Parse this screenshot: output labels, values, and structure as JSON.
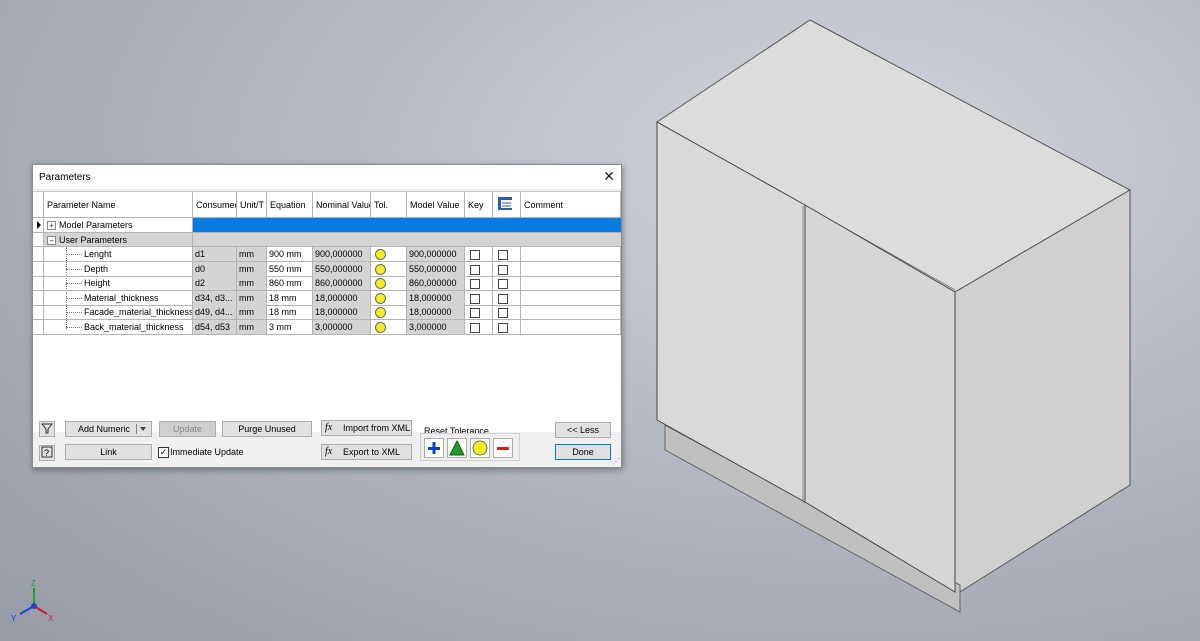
{
  "dialog": {
    "title": "Parameters",
    "close_glyph": "✕"
  },
  "columns": [
    "Parameter Name",
    "Consumed",
    "Unit/T",
    "Equation",
    "Nominal Value",
    "Tol.",
    "Key",
    "Comment",
    "Model Value"
  ],
  "groups": {
    "model": "Model Parameters",
    "user": "User Parameters"
  },
  "params": [
    {
      "name": "Lenght",
      "consumed": "d1",
      "unit": "mm",
      "equation": "900 mm",
      "nominal": "900,000000",
      "model": "900,000000"
    },
    {
      "name": "Depth",
      "consumed": "d0",
      "unit": "mm",
      "equation": "550 mm",
      "nominal": "550,000000",
      "model": "550,000000"
    },
    {
      "name": "Height",
      "consumed": "d2",
      "unit": "mm",
      "equation": "860 mm",
      "nominal": "860,000000",
      "model": "860,000000"
    },
    {
      "name": "Material_thickness",
      "consumed": "d34, d3...",
      "unit": "mm",
      "equation": "18 mm",
      "nominal": "18,000000",
      "model": "18,000000"
    },
    {
      "name": "Facade_material_thickness",
      "consumed": "d49, d4...",
      "unit": "mm",
      "equation": "18 mm",
      "nominal": "18,000000",
      "model": "18,000000"
    },
    {
      "name": "Back_material_thickness",
      "consumed": "d54, d53",
      "unit": "mm",
      "equation": "3 mm",
      "nominal": "3,000000",
      "model": "3,000000"
    }
  ],
  "buttons": {
    "add_numeric": "Add Numeric",
    "update": "Update",
    "purge": "Purge Unused",
    "import_xml": "Import from XML",
    "export_xml": "Export to XML",
    "link": "Link",
    "less": "<< Less",
    "done": "Done",
    "immediate_update": "Immediate Update",
    "reset_tolerance": "Reset Tolerance"
  },
  "colors": {
    "selection": "#0a7be0",
    "tol_circle": "#f7ee22",
    "tol_plus": "#1040c0",
    "tol_triangle": "#18a028",
    "tol_minus": "#d02020"
  },
  "viewcube_axes": {
    "x": "X",
    "y": "Y",
    "z": "Z"
  }
}
